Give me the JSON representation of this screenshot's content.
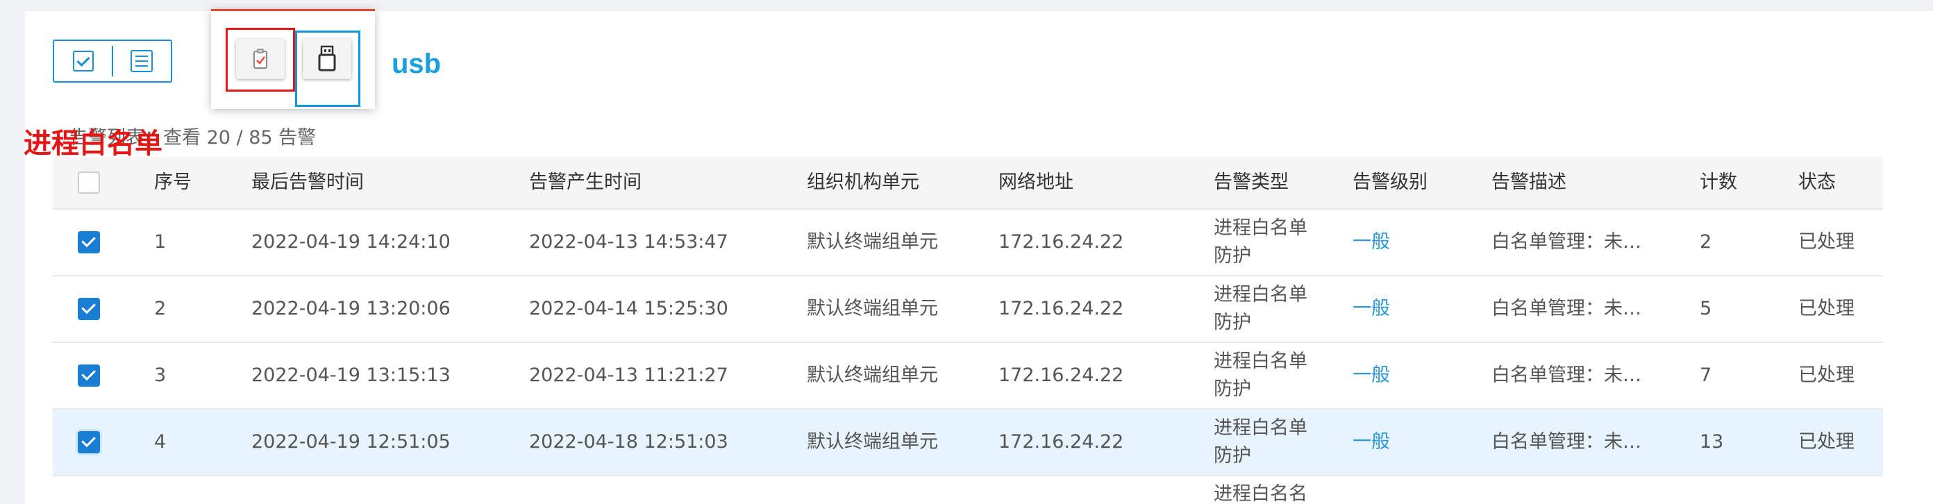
{
  "annotations": {
    "usb_label": "usb",
    "whitelist_label": "进程白名单"
  },
  "summary": {
    "text": "告警列表：查看 20 / 85 告警"
  },
  "table": {
    "headers": [
      "序号",
      "最后告警时间",
      "告警产生时间",
      "组织机构单元",
      "网络地址",
      "告警类型",
      "告警级别",
      "告警描述",
      "计数",
      "状态"
    ],
    "rows": [
      {
        "no": "1",
        "last": "2022-04-19 14:24:10",
        "first": "2022-04-13 14:53:47",
        "org": "默认终端组单元",
        "ip": "172.16.24.22",
        "type": "进程白名单防护",
        "level": "一般",
        "desc": "白名单管理：未…",
        "count": "2",
        "status": "已处理",
        "checked": true
      },
      {
        "no": "2",
        "last": "2022-04-19 13:20:06",
        "first": "2022-04-14 15:25:30",
        "org": "默认终端组单元",
        "ip": "172.16.24.22",
        "type": "进程白名单防护",
        "level": "一般",
        "desc": "白名单管理：未…",
        "count": "5",
        "status": "已处理",
        "checked": true
      },
      {
        "no": "3",
        "last": "2022-04-19 13:15:13",
        "first": "2022-04-13 11:21:27",
        "org": "默认终端组单元",
        "ip": "172.16.24.22",
        "type": "进程白名单防护",
        "level": "一般",
        "desc": "白名单管理：未…",
        "count": "7",
        "status": "已处理",
        "checked": true
      },
      {
        "no": "4",
        "last": "2022-04-19 12:51:05",
        "first": "2022-04-18 12:51:03",
        "org": "默认终端组单元",
        "ip": "172.16.24.22",
        "type": "进程白名单防护",
        "level": "一般",
        "desc": "白名单管理：未…",
        "count": "13",
        "status": "已处理",
        "checked": true
      }
    ],
    "partial_row": {
      "type": "进程白名名"
    }
  },
  "colors": {
    "accent": "#1890d6",
    "highlight_red": "#e51616",
    "highlight_blue": "#1296db",
    "row_hover": "#e8f4fd"
  },
  "icons": {
    "toggle_left": "checkbox-view-icon",
    "toggle_right": "list-view-icon",
    "popup_left": "process-whitelist-icon",
    "popup_right": "usb-icon"
  }
}
